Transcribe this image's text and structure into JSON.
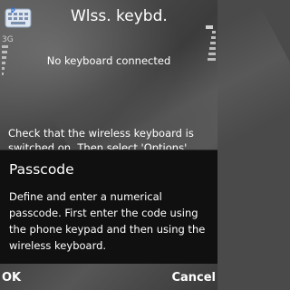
{
  "header": {
    "title": "Wlss. keybd.",
    "app_icon": "wireless-keyboard-icon",
    "network": "3G"
  },
  "status": {
    "message": "No keyboard connected"
  },
  "background_text": {
    "line1": "Check that the wireless keyboard is",
    "line2": "switched on. Then select 'Options'"
  },
  "dialog": {
    "title": "Passcode",
    "body": "Define and enter a numerical passcode. First enter the code using the phone keypad and then using the wireless keyboard."
  },
  "softkeys": {
    "left": "OK",
    "right": "Cancel"
  },
  "colors": {
    "dialog_bg": "#101010",
    "wallpaper": "#4a4a4a",
    "text": "#ffffff"
  }
}
